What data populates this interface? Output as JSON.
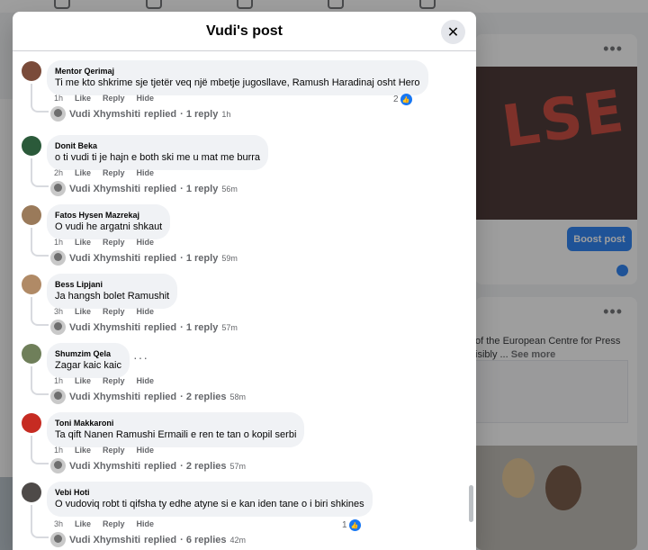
{
  "background": {
    "boost_label": "Boost post",
    "card2_text_1": "of the European Centre for Press",
    "card2_text_2": "isibly ...",
    "card2_see_more": "See more"
  },
  "modal": {
    "title": "Vudi's post",
    "close_icon": "close-icon"
  },
  "action_labels": {
    "like": "Like",
    "reply": "Reply",
    "hide": "Hide"
  },
  "comments": [
    {
      "author": "Mentor Qerimaj",
      "text": "Ti me kto shkrime sje tjetër veq një mbetje jugosllave, Ramush Haradinaj osht Hero",
      "time": "1h",
      "reactions": "2",
      "reply_author": "Vudi Xhymshiti",
      "reply_verb": "replied",
      "reply_count": "· 1 reply",
      "reply_time": "1h"
    },
    {
      "author": "Donit Beka",
      "text": "o ti vudi ti je hajn e both ski me u mat me burra",
      "time": "2h",
      "reactions": "",
      "reply_author": "Vudi Xhymshiti",
      "reply_verb": "replied",
      "reply_count": "· 1 reply",
      "reply_time": "56m"
    },
    {
      "author": "Fatos Hysen Mazrekaj",
      "text": "O vudi he argatni shkaut",
      "time": "1h",
      "reactions": "",
      "reply_author": "Vudi Xhymshiti",
      "reply_verb": "replied",
      "reply_count": "· 1 reply",
      "reply_time": "59m"
    },
    {
      "author": "Bess Lipjani",
      "text": "Ja hangsh bolet Ramushit",
      "time": "3h",
      "reactions": "",
      "reply_author": "Vudi Xhymshiti",
      "reply_verb": "replied",
      "reply_count": "· 1 reply",
      "reply_time": "57m"
    },
    {
      "author": "Shumzim Qela",
      "text": "Zagar kaic kaic",
      "time": "1h",
      "reactions": "",
      "reply_author": "Vudi Xhymshiti",
      "reply_verb": "replied",
      "reply_count": "· 2 replies",
      "reply_time": "58m"
    },
    {
      "author": "Toni Makkaroni",
      "text": "Ta qift Nanen Ramushi Ermaili e ren te tan o kopil serbi",
      "time": "1h",
      "reactions": "",
      "reply_author": "Vudi Xhymshiti",
      "reply_verb": "replied",
      "reply_count": "· 2 replies",
      "reply_time": "57m"
    },
    {
      "author": "Vebi Hoti",
      "text": "O vudoviq robt ti qifsha ty edhe atyne si e kan iden tane o i biri shkines",
      "time": "3h",
      "reactions": "1",
      "reply_author": "Vudi Xhymshiti",
      "reply_verb": "replied",
      "reply_count": "· 6 replies",
      "reply_time": "42m"
    }
  ],
  "colors": {
    "accent": "#1877f2",
    "bubble": "#f0f2f5",
    "secondary_text": "#65676b"
  }
}
